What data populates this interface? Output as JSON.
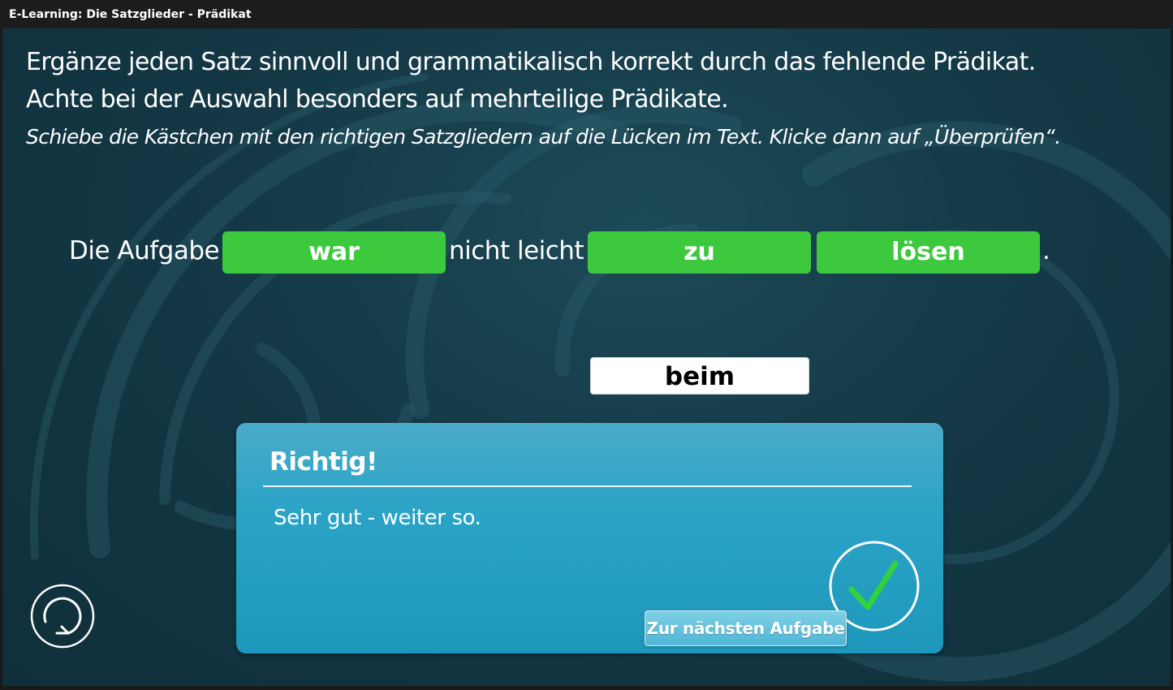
{
  "window": {
    "title": "E-Learning: Die Satzglieder - Prädikat"
  },
  "instructions": {
    "line1": "Ergänze jeden Satz sinnvoll und grammatikalisch korrekt durch das fehlende Prädikat.",
    "line2": "Achte bei der Auswahl besonders auf mehrteilige Prädikate.",
    "line3": "Schiebe die Kästchen mit den richtigen Satzgliedern auf die Lücken im Text. Klicke dann auf „Überprüfen“."
  },
  "sentence": {
    "part1": "Die Aufgabe",
    "slot1": "war",
    "part2": "nicht leicht",
    "slot2": "zu",
    "slot3": "lösen",
    "end": "."
  },
  "options": {
    "remaining_chip": "beim"
  },
  "feedback": {
    "title": "Richtig!",
    "message": "Sehr gut - weiter so.",
    "next_button": "Zur nächsten Aufgabe"
  },
  "icons": {
    "check": "check-icon",
    "reset": "reset-icon"
  },
  "colors": {
    "slot_green": "#3cc93e",
    "panel_blue": "#2aa3c6",
    "background": "#143846"
  }
}
